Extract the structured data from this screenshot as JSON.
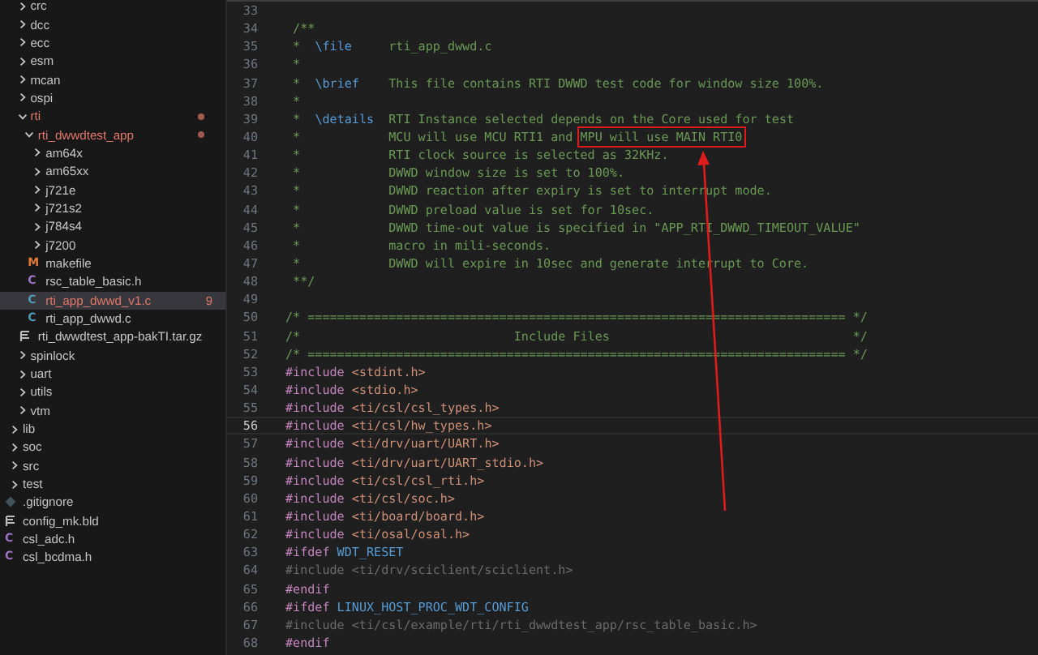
{
  "explorer": {
    "items": [
      {
        "label": "crc",
        "kind": "folder",
        "expanded": false,
        "modified": false,
        "selected": false
      },
      {
        "label": "dcc",
        "kind": "folder",
        "expanded": false,
        "modified": false,
        "selected": false
      },
      {
        "label": "ecc",
        "kind": "folder",
        "expanded": false,
        "modified": false,
        "selected": false
      },
      {
        "label": "esm",
        "kind": "folder",
        "expanded": false,
        "modified": false,
        "selected": false
      },
      {
        "label": "mcan",
        "kind": "folder",
        "expanded": false,
        "modified": false,
        "selected": false
      },
      {
        "label": "ospi",
        "kind": "folder",
        "expanded": false,
        "modified": false,
        "selected": false
      },
      {
        "label": "rti",
        "kind": "folder",
        "expanded": true,
        "modified": true,
        "selected": false,
        "children": [
          {
            "label": "rti_dwwdtest_app",
            "kind": "folder",
            "expanded": true,
            "modified": true,
            "selected": false,
            "children": [
              {
                "label": "am64x",
                "kind": "folder",
                "expanded": false,
                "modified": false,
                "selected": false
              },
              {
                "label": "am65xx",
                "kind": "folder",
                "expanded": false,
                "modified": false,
                "selected": false
              },
              {
                "label": "j721e",
                "kind": "folder",
                "expanded": false,
                "modified": false,
                "selected": false
              },
              {
                "label": "j721s2",
                "kind": "folder",
                "expanded": false,
                "modified": false,
                "selected": false
              },
              {
                "label": "j784s4",
                "kind": "folder",
                "expanded": false,
                "modified": false,
                "selected": false
              },
              {
                "label": "j7200",
                "kind": "folder",
                "expanded": false,
                "modified": false,
                "selected": false
              },
              {
                "label": "makefile",
                "kind": "makefile",
                "glyph": "M",
                "modified": false,
                "selected": false
              },
              {
                "label": "rsc_table_basic.h",
                "kind": "c-header",
                "glyph": "C",
                "modified": false,
                "selected": false
              },
              {
                "label": "rti_app_dwwd_v1.c",
                "kind": "c-source",
                "glyph": "C",
                "modified": true,
                "badge": "9",
                "selected": true
              },
              {
                "label": "rti_app_dwwd.c",
                "kind": "c-source",
                "glyph": "C",
                "modified": false,
                "selected": false
              }
            ]
          },
          {
            "label": "rti_dwwdtest_app-bakTI.tar.gz",
            "kind": "archive",
            "modified": false,
            "selected": false
          }
        ]
      },
      {
        "label": "spinlock",
        "kind": "folder",
        "expanded": false,
        "modified": false,
        "selected": false
      },
      {
        "label": "uart",
        "kind": "folder",
        "expanded": false,
        "modified": false,
        "selected": false
      },
      {
        "label": "utils",
        "kind": "folder",
        "expanded": false,
        "modified": false,
        "selected": false
      },
      {
        "label": "vtm",
        "kind": "folder",
        "expanded": false,
        "modified": false,
        "selected": false
      }
    ],
    "roots": [
      {
        "label": "lib",
        "kind": "folder",
        "expanded": false,
        "modified": false,
        "selected": false
      },
      {
        "label": "soc",
        "kind": "folder",
        "expanded": false,
        "modified": false,
        "selected": false
      },
      {
        "label": "src",
        "kind": "folder",
        "expanded": false,
        "modified": false,
        "selected": false
      },
      {
        "label": "test",
        "kind": "folder",
        "expanded": false,
        "modified": false,
        "selected": false
      },
      {
        "label": ".gitignore",
        "kind": "gitignore",
        "modified": false,
        "selected": false
      },
      {
        "label": "config_mk.bld",
        "kind": "archive",
        "modified": false,
        "selected": false
      },
      {
        "label": "csl_adc.h",
        "kind": "c-header",
        "glyph": "C",
        "modified": false,
        "selected": false
      },
      {
        "label": "csl_bcdma.h",
        "kind": "c-header",
        "glyph": "C",
        "modified": false,
        "selected": false
      }
    ]
  },
  "editor": {
    "lines": [
      {
        "number": "33",
        "current": false
      },
      {
        "number": "34",
        "current": false,
        "tokens": [
          {
            "kind": "comment",
            "text": " /**"
          }
        ]
      },
      {
        "number": "35",
        "current": false,
        "tokens": [
          {
            "kind": "comment",
            "text": " *  "
          },
          {
            "kind": "doc-tag",
            "text": "\\file"
          },
          {
            "kind": "comment",
            "text": "     rti_app_dwwd.c"
          }
        ]
      },
      {
        "number": "36",
        "current": false,
        "tokens": [
          {
            "kind": "comment",
            "text": " *"
          }
        ]
      },
      {
        "number": "37",
        "current": false,
        "tokens": [
          {
            "kind": "comment",
            "text": " *  "
          },
          {
            "kind": "doc-tag",
            "text": "\\brief"
          },
          {
            "kind": "comment",
            "text": "    This file contains RTI DWWD test code for window size 100%."
          }
        ]
      },
      {
        "number": "38",
        "current": false,
        "tokens": [
          {
            "kind": "comment",
            "text": " *"
          }
        ]
      },
      {
        "number": "39",
        "current": false,
        "tokens": [
          {
            "kind": "comment",
            "text": " *  "
          },
          {
            "kind": "doc-tag",
            "text": "\\details"
          },
          {
            "kind": "comment",
            "text": "  RTI Instance selected depends on the Core used for test"
          }
        ]
      },
      {
        "number": "40",
        "current": false,
        "tokens": [
          {
            "kind": "comment",
            "text": " *            MCU will use MCU RTI1 and "
          },
          {
            "kind": "annotated",
            "text": "MPU will use MAIN RTI0"
          }
        ]
      },
      {
        "number": "41",
        "current": false,
        "tokens": [
          {
            "kind": "comment",
            "text": " *            RTI clock source is selected as 32KHz."
          }
        ]
      },
      {
        "number": "42",
        "current": false,
        "tokens": [
          {
            "kind": "comment",
            "text": " *            DWWD window size is set to 100%."
          }
        ]
      },
      {
        "number": "43",
        "current": false,
        "tokens": [
          {
            "kind": "comment",
            "text": " *            DWWD reaction after expiry is set to interrupt mode."
          }
        ]
      },
      {
        "number": "44",
        "current": false,
        "tokens": [
          {
            "kind": "comment",
            "text": " *            DWWD preload value is set for 10sec."
          }
        ]
      },
      {
        "number": "45",
        "current": false,
        "tokens": [
          {
            "kind": "comment",
            "text": " *            DWWD time-out value is specified in \"APP_RTI_DWWD_TIMEOUT_VALUE\""
          }
        ]
      },
      {
        "number": "46",
        "current": false,
        "tokens": [
          {
            "kind": "comment",
            "text": " *            macro in mili-seconds."
          }
        ]
      },
      {
        "number": "47",
        "current": false,
        "tokens": [
          {
            "kind": "comment",
            "text": " *            DWWD will expire in 10sec and generate interrupt to Core."
          }
        ]
      },
      {
        "number": "48",
        "current": false,
        "tokens": [
          {
            "kind": "comment",
            "text": " **/"
          }
        ]
      },
      {
        "number": "49",
        "current": false
      },
      {
        "number": "50",
        "current": false,
        "tokens": [
          {
            "kind": "comment",
            "text": "/* ========================================================================= */"
          }
        ]
      },
      {
        "number": "51",
        "current": false,
        "tokens": [
          {
            "kind": "comment",
            "text": "/*                             Include Files                                 */"
          }
        ]
      },
      {
        "number": "52",
        "current": false,
        "tokens": [
          {
            "kind": "comment",
            "text": "/* ========================================================================= */"
          }
        ]
      },
      {
        "number": "53",
        "current": false,
        "tokens": [
          {
            "kind": "directive",
            "text": "#include"
          },
          {
            "kind": "header",
            "text": " <stdint.h>"
          }
        ]
      },
      {
        "number": "54",
        "current": false,
        "tokens": [
          {
            "kind": "directive",
            "text": "#include"
          },
          {
            "kind": "header",
            "text": " <stdio.h>"
          }
        ]
      },
      {
        "number": "55",
        "current": false,
        "tokens": [
          {
            "kind": "directive",
            "text": "#include"
          },
          {
            "kind": "header",
            "text": " <ti/csl/csl_types.h>"
          }
        ]
      },
      {
        "number": "56",
        "current": true,
        "tokens": [
          {
            "kind": "directive",
            "text": "#include"
          },
          {
            "kind": "header",
            "text": " <ti/csl/hw_types.h>"
          }
        ]
      },
      {
        "number": "57",
        "current": false,
        "tokens": [
          {
            "kind": "directive",
            "text": "#include"
          },
          {
            "kind": "header",
            "text": " <ti/drv/uart/UART.h>"
          }
        ]
      },
      {
        "number": "58",
        "current": false,
        "tokens": [
          {
            "kind": "directive",
            "text": "#include"
          },
          {
            "kind": "header",
            "text": " <ti/drv/uart/UART_stdio.h>"
          }
        ]
      },
      {
        "number": "59",
        "current": false,
        "tokens": [
          {
            "kind": "directive",
            "text": "#include"
          },
          {
            "kind": "header",
            "text": " <ti/csl/csl_rti.h>"
          }
        ]
      },
      {
        "number": "60",
        "current": false,
        "tokens": [
          {
            "kind": "directive",
            "text": "#include"
          },
          {
            "kind": "header",
            "text": " <ti/csl/soc.h>"
          }
        ]
      },
      {
        "number": "61",
        "current": false,
        "tokens": [
          {
            "kind": "directive",
            "text": "#include"
          },
          {
            "kind": "header",
            "text": " <ti/board/board.h>"
          }
        ]
      },
      {
        "number": "62",
        "current": false,
        "tokens": [
          {
            "kind": "directive",
            "text": "#include"
          },
          {
            "kind": "header",
            "text": " <ti/osal/osal.h>"
          }
        ]
      },
      {
        "number": "63",
        "current": false,
        "tokens": [
          {
            "kind": "directive",
            "text": "#ifdef"
          },
          {
            "kind": "macro",
            "text": " WDT_RESET"
          }
        ]
      },
      {
        "number": "64",
        "current": false,
        "tokens": [
          {
            "kind": "inactive",
            "text": "#include <ti/drv/sciclient/sciclient.h>"
          }
        ]
      },
      {
        "number": "65",
        "current": false,
        "tokens": [
          {
            "kind": "directive",
            "text": "#endif"
          }
        ]
      },
      {
        "number": "66",
        "current": false,
        "tokens": [
          {
            "kind": "directive",
            "text": "#ifdef"
          },
          {
            "kind": "macro",
            "text": " LINUX_HOST_PROC_WDT_CONFIG"
          }
        ]
      },
      {
        "number": "67",
        "current": false,
        "tokens": [
          {
            "kind": "inactive",
            "text": "#include <ti/csl/example/rti/rti_dwwdtest_app/rsc_table_basic.h>"
          }
        ]
      },
      {
        "number": "68",
        "current": false,
        "tokens": [
          {
            "kind": "directive",
            "text": "#endif"
          }
        ]
      }
    ]
  }
}
